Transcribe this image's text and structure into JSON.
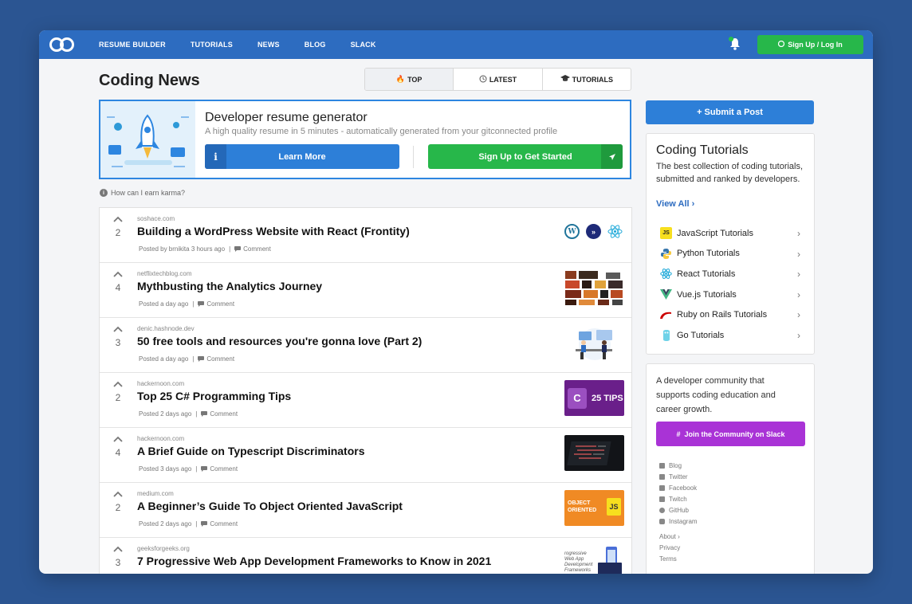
{
  "nav": {
    "items": [
      "RESUME BUILDER",
      "TUTORIALS",
      "NEWS",
      "BLOG",
      "SLACK"
    ],
    "signup_label": "Sign Up / Log In"
  },
  "page_title": "Coding News",
  "tabs": [
    {
      "icon": "fire-icon",
      "label": "TOP"
    },
    {
      "icon": "clock-icon",
      "label": "LATEST"
    },
    {
      "icon": "graduation-cap-icon",
      "label": "TUTORIALS"
    }
  ],
  "promo": {
    "title": "Developer resume generator",
    "subtitle": "A high quality resume in 5 minutes - automatically generated from your gitconnected profile",
    "learn_more": "Learn More",
    "get_started": "Sign Up to Get Started"
  },
  "karma_text": "How can I earn karma?",
  "posts": [
    {
      "votes": "2",
      "domain": "soshace.com",
      "title": "Building a WordPress Website with React (Frontity)",
      "posted": "Posted by brnikita 3 hours ago",
      "comment": "Comment"
    },
    {
      "votes": "4",
      "domain": "netflixtechblog.com",
      "title": "Mythbusting the Analytics Journey",
      "posted": "Posted a day ago",
      "comment": "Comment"
    },
    {
      "votes": "3",
      "domain": "denic.hashnode.dev",
      "title": "50 free tools and resources you're gonna love (Part 2)",
      "posted": "Posted a day ago",
      "comment": "Comment"
    },
    {
      "votes": "2",
      "domain": "hackernoon.com",
      "title": "Top 25 C# Programming Tips",
      "posted": "Posted 2 days ago",
      "comment": "Comment",
      "thumb_text": "25 TIPS"
    },
    {
      "votes": "4",
      "domain": "hackernoon.com",
      "title": "A Brief Guide on Typescript Discriminators",
      "posted": "Posted 3 days ago",
      "comment": "Comment"
    },
    {
      "votes": "2",
      "domain": "medium.com",
      "title": "A Beginner’s Guide To Object Oriented JavaScript",
      "posted": "Posted 2 days ago",
      "comment": "Comment",
      "thumb_text": "OBJECT ORIENTED"
    },
    {
      "votes": "3",
      "domain": "geeksforgeeks.org",
      "title": "7 Progressive Web App Development Frameworks to Know in 2021",
      "posted": "",
      "comment": "",
      "thumb_text": "rogressive Web App Development Frameworks"
    }
  ],
  "sidebar": {
    "submit_label": "+ Submit a Post",
    "tutorials_title": "Coding Tutorials",
    "tutorials_desc": "The best collection of coding tutorials, submitted and ranked by developers.",
    "view_all": "View All",
    "tutorials": [
      {
        "label": "JavaScript Tutorials",
        "icon": "javascript-icon",
        "badge": "JS",
        "color": "#f7df1e"
      },
      {
        "label": "Python Tutorials",
        "icon": "python-icon",
        "color": "#3776ab"
      },
      {
        "label": "React Tutorials",
        "icon": "react-icon",
        "color": "#61dafb"
      },
      {
        "label": "Vue.js Tutorials",
        "icon": "vue-icon",
        "color": "#42b883"
      },
      {
        "label": "Ruby on Rails Tutorials",
        "icon": "rails-icon",
        "color": "#cc0000"
      },
      {
        "label": "Go Tutorials",
        "icon": "go-icon",
        "color": "#00add8"
      }
    ],
    "community_text": "A developer community that supports coding education and career growth.",
    "slack_label": "Join the Community on Slack",
    "social": [
      "Blog",
      "Twitter",
      "Facebook",
      "Twitch",
      "GitHub",
      "Instagram"
    ],
    "footer": [
      "About",
      "Privacy",
      "Terms"
    ]
  },
  "colors": {
    "brand_blue": "#2d6cc0",
    "green": "#27b74a",
    "purple": "#a933d6"
  }
}
